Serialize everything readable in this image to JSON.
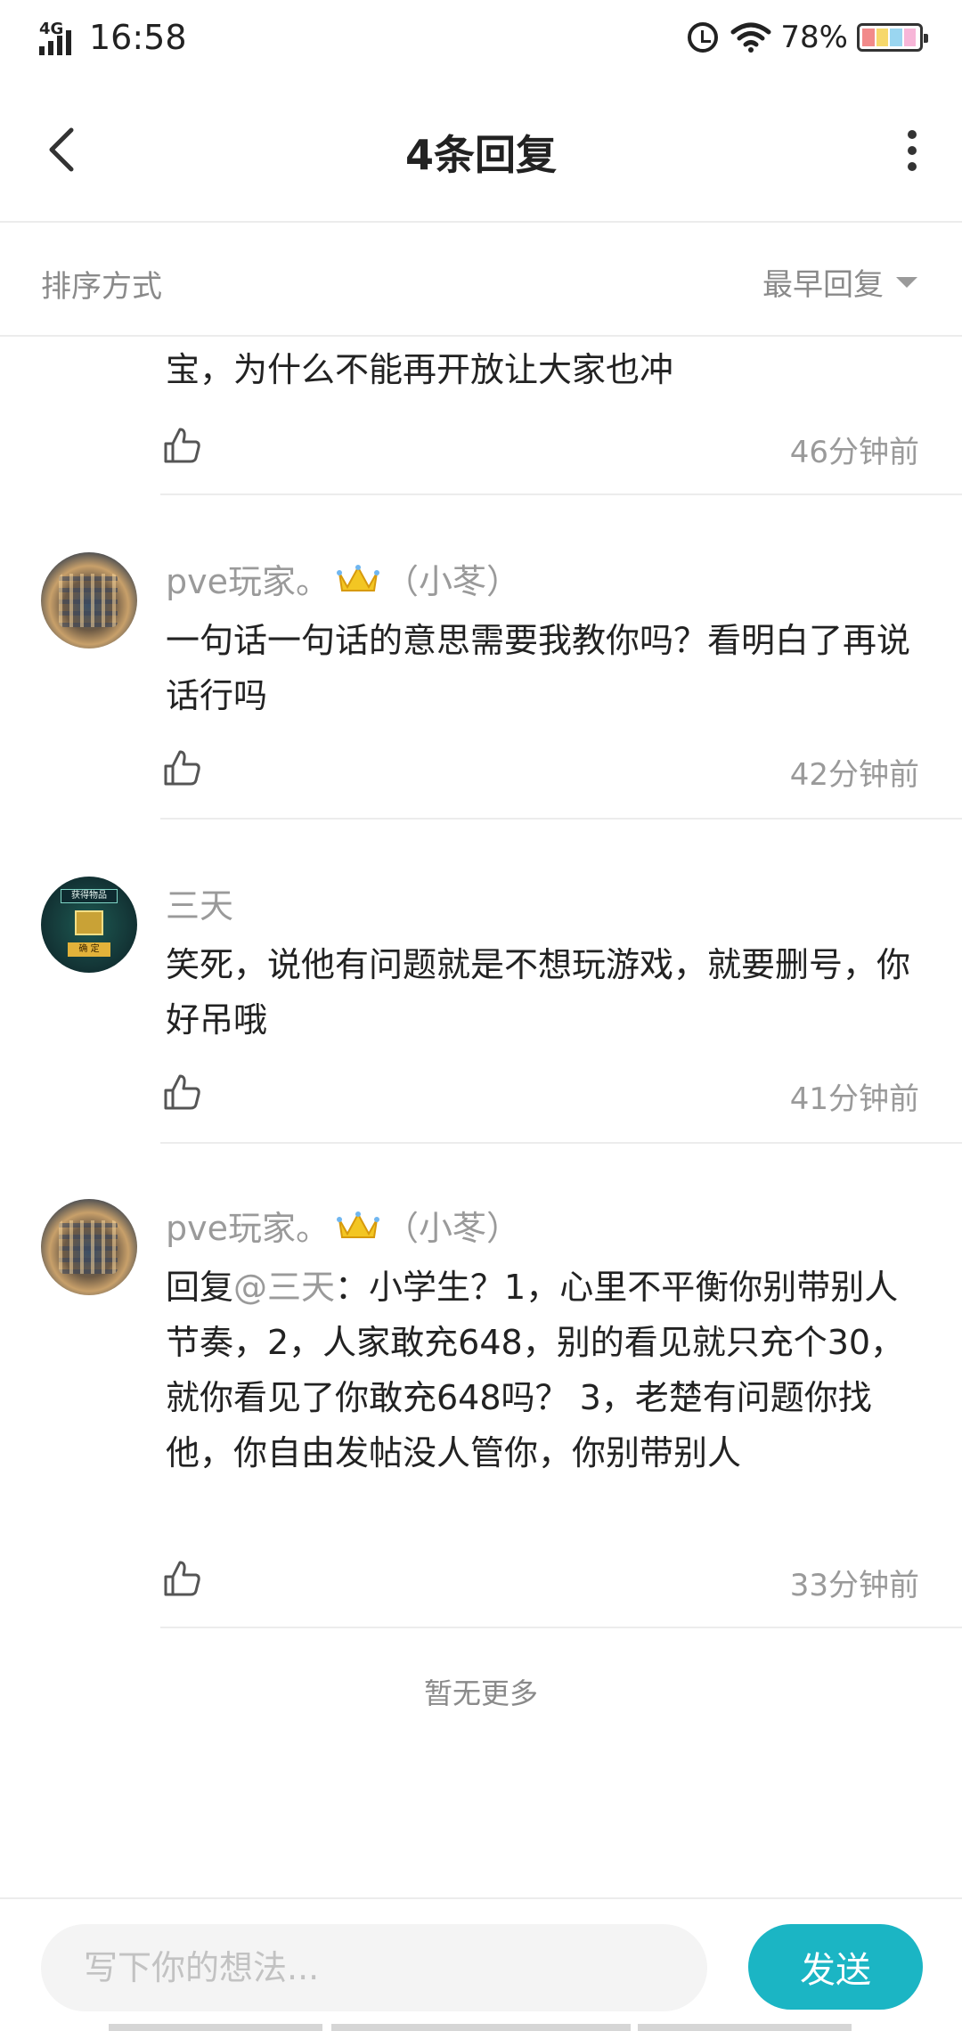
{
  "status_bar": {
    "network": "4G",
    "time": "16:58",
    "battery": "78%",
    "battery_colors": [
      "#f28a8a",
      "#f6d86b",
      "#9ad6f0",
      "#f7b6d8"
    ]
  },
  "header": {
    "title": "4条回复"
  },
  "sort": {
    "label": "排序方式",
    "value": "最早回复"
  },
  "comments": [
    {
      "text": "宝，为什么不能再开放让大家也冲",
      "time": "46分钟前"
    },
    {
      "username": "pve玩家。",
      "tag": "（小苳）",
      "text": "一句话一句话的意思需要我教你吗？看明白了再说话行吗",
      "time": "42分钟前",
      "avatar": "city-avatar"
    },
    {
      "username": "三天",
      "text": "笑死，说他有问题就是不想玩游戏，就要删号，你好吊哦",
      "time": "41分钟前",
      "avatar": "game-avatar",
      "avatar_text": {
        "title": "获得物品",
        "button": "确 定"
      }
    },
    {
      "username": "pve玩家。",
      "tag": "（小苳）",
      "reply_prefix": "回复",
      "mention": "@三天",
      "text": "：小学生？1，心里不平衡你别带别人节奏，2，人家敢充648，别的看见就只充个30，就你看见了你敢充648吗？ 3，老楚有问题你找他，你自由发帖没人管你，你别带别人",
      "time": "33分钟前",
      "avatar": "city-avatar"
    }
  ],
  "footer_note": "暂无更多",
  "input": {
    "placeholder": "写下你的想法...",
    "send_label": "发送"
  },
  "colors": {
    "accent": "#1bb5c4",
    "divider": "#ececec",
    "muted_text": "#9a9a9a"
  }
}
